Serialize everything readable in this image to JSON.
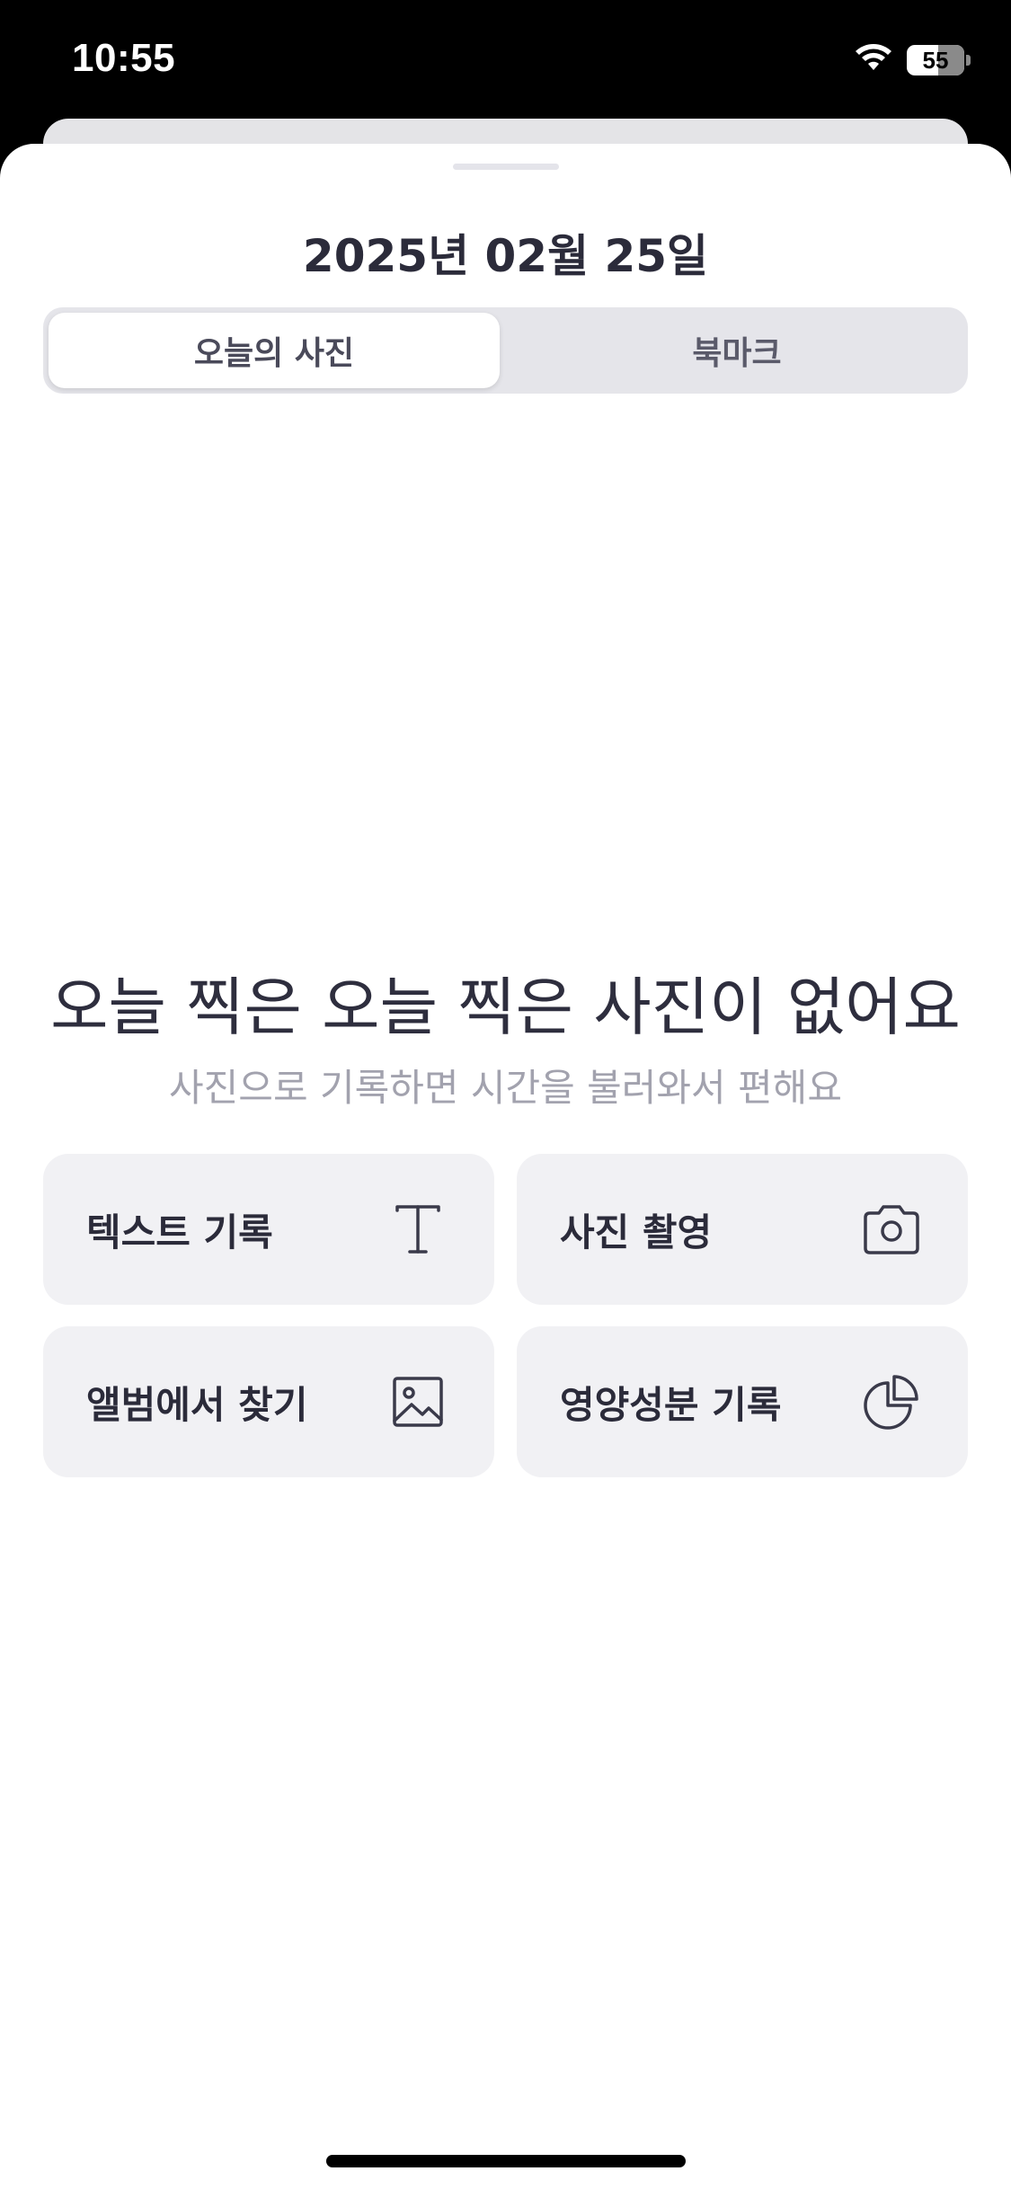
{
  "status_bar": {
    "time": "10:55",
    "battery_level": "55",
    "battery_fraction": 0.55
  },
  "sheet": {
    "title": "2025년 02월 25일",
    "tabs": [
      {
        "label": "오늘의 사진",
        "selected": true
      },
      {
        "label": "북마크",
        "selected": false
      }
    ]
  },
  "empty_state": {
    "title": "오늘 찍은 오늘 찍은 사진이 없어요",
    "subtitle": "사진으로 기록하면 시간을 불러와서 편해요"
  },
  "actions": [
    {
      "label": "텍스트 기록",
      "icon": "text-icon"
    },
    {
      "label": "사진 촬영",
      "icon": "camera-icon"
    },
    {
      "label": "앨범에서 찾기",
      "icon": "image-icon"
    },
    {
      "label": "영양성분 기록",
      "icon": "pie-chart-icon"
    }
  ],
  "colors": {
    "text_primary": "#2b2b3a",
    "text_secondary": "#a2a2ae",
    "card_background": "#f1f1f4",
    "segment_background": "#e5e5ea"
  }
}
